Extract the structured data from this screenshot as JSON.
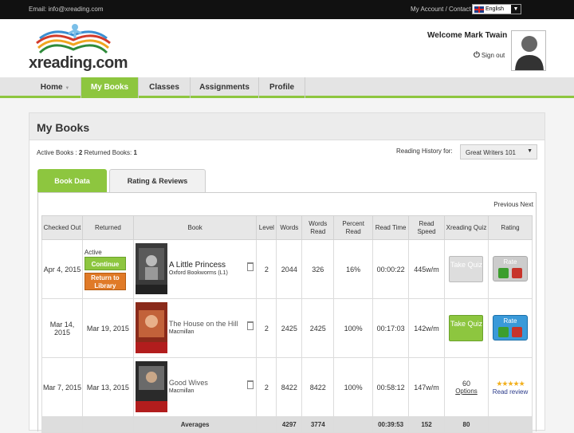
{
  "topbar": {
    "email": "Email: info@xreading.com",
    "links": "My Account / Contact /",
    "language": "English"
  },
  "header": {
    "logo_text": "xreading.com",
    "welcome": "Welcome Mark Twain",
    "signout": "Sign out"
  },
  "nav": {
    "items": [
      {
        "label": "Home"
      },
      {
        "label": "My Books"
      },
      {
        "label": "Classes"
      },
      {
        "label": "Assignments"
      },
      {
        "label": "Profile"
      }
    ],
    "active": "My Books"
  },
  "page": {
    "title": "My Books",
    "active_books_label": "Active Books :",
    "active_books_count": "2",
    "returned_books_label": "Returned Books:",
    "returned_books_count": "1",
    "history_label": "Reading History for:",
    "history_value": "Great Writers 101"
  },
  "tabs": [
    {
      "label": "Book Data"
    },
    {
      "label": "Rating & Reviews"
    }
  ],
  "pagination": "Previous Next",
  "table": {
    "headers": {
      "checked_out": "Checked Out",
      "returned": "Returned",
      "book": "Book",
      "level": "Level",
      "words": "Words",
      "words_read": "Words Read",
      "percent_read": "Percent Read",
      "read_time": "Read Time",
      "read_speed": "Read Speed",
      "quiz": "Xreading Quiz",
      "rating": "Rating"
    },
    "rows": [
      {
        "checked_out": "Apr 4, 2015",
        "status": "Active",
        "continue": "Continue",
        "return": "Return to Library",
        "title": "A Little Princess",
        "publisher": "Oxford Bookworms (L1)",
        "level": "2",
        "words": "2044",
        "words_read": "326",
        "percent": "16%",
        "time": "00:00:22",
        "speed": "445w/m",
        "quiz": "Take Quiz",
        "rate": "Rate"
      },
      {
        "checked_out": "Mar 14, 2015",
        "returned": "Mar 19, 2015",
        "title": "The House on the Hill",
        "publisher": "Macmillan",
        "level": "2",
        "words": "2425",
        "words_read": "2425",
        "percent": "100%",
        "time": "00:17:03",
        "speed": "142w/m",
        "quiz": "Take Quiz",
        "rate": "Rate"
      },
      {
        "checked_out": "Mar 7, 2015",
        "returned": "Mar 13, 2015",
        "title": "Good Wives",
        "publisher": "Macmillan",
        "level": "2",
        "words": "8422",
        "words_read": "8422",
        "percent": "100%",
        "time": "00:58:12",
        "speed": "147w/m",
        "quiz_score": "60",
        "quiz_options": "Options",
        "stars": "★★★★★",
        "read_review": "Read review"
      }
    ],
    "averages": {
      "label": "Averages",
      "words": "4297",
      "words_read": "3774",
      "time": "00:39:53",
      "speed": "152",
      "quiz": "80"
    }
  },
  "colors": {
    "accent_green": "#8dc63f",
    "return_orange": "#e07a27",
    "rate_blue": "#3a9ad9"
  }
}
